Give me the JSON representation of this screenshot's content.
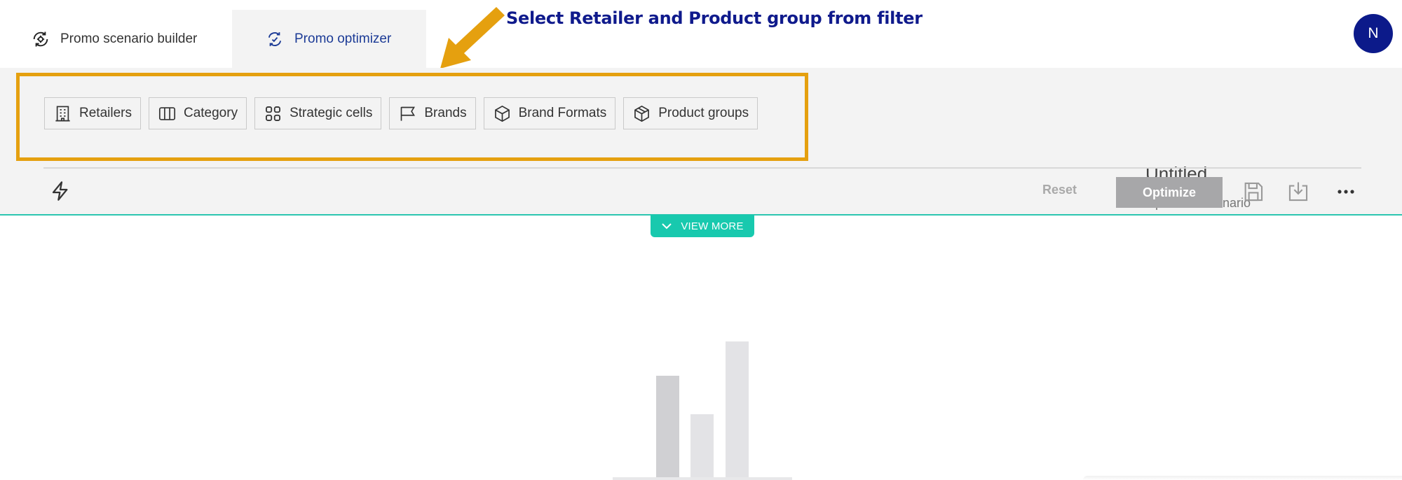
{
  "tabs": [
    {
      "label": "Promo scenario builder",
      "icon": "gear-cycle-icon",
      "active": false
    },
    {
      "label": "Promo optimizer",
      "icon": "optimizer-cycle-icon",
      "active": true
    }
  ],
  "annotation": {
    "text": "Select Retailer and Product group from filter",
    "color": "#0f1a8c",
    "arrow_color": "#e5a00f"
  },
  "user": {
    "avatar_initial": "N"
  },
  "filters": [
    {
      "label": "Retailers",
      "icon": "building-icon"
    },
    {
      "label": "Category",
      "icon": "columns-icon"
    },
    {
      "label": "Strategic cells",
      "icon": "grid-icon"
    },
    {
      "label": "Brands",
      "icon": "flag-icon"
    },
    {
      "label": "Brand Formats",
      "icon": "box-icon"
    },
    {
      "label": "Product groups",
      "icon": "box-icon"
    }
  ],
  "scenario": {
    "title": "Untitled",
    "subtitle": "Optimizer scenario"
  },
  "toolbar": {
    "reset_label": "Reset",
    "optimize_label": "Optimize"
  },
  "view_more": {
    "label": "VIEW MORE"
  },
  "colors": {
    "accent": "#18c9ae",
    "highlight": "#e5a00f",
    "brand": "#0c1a8a",
    "panel": "#f3f3f3"
  }
}
